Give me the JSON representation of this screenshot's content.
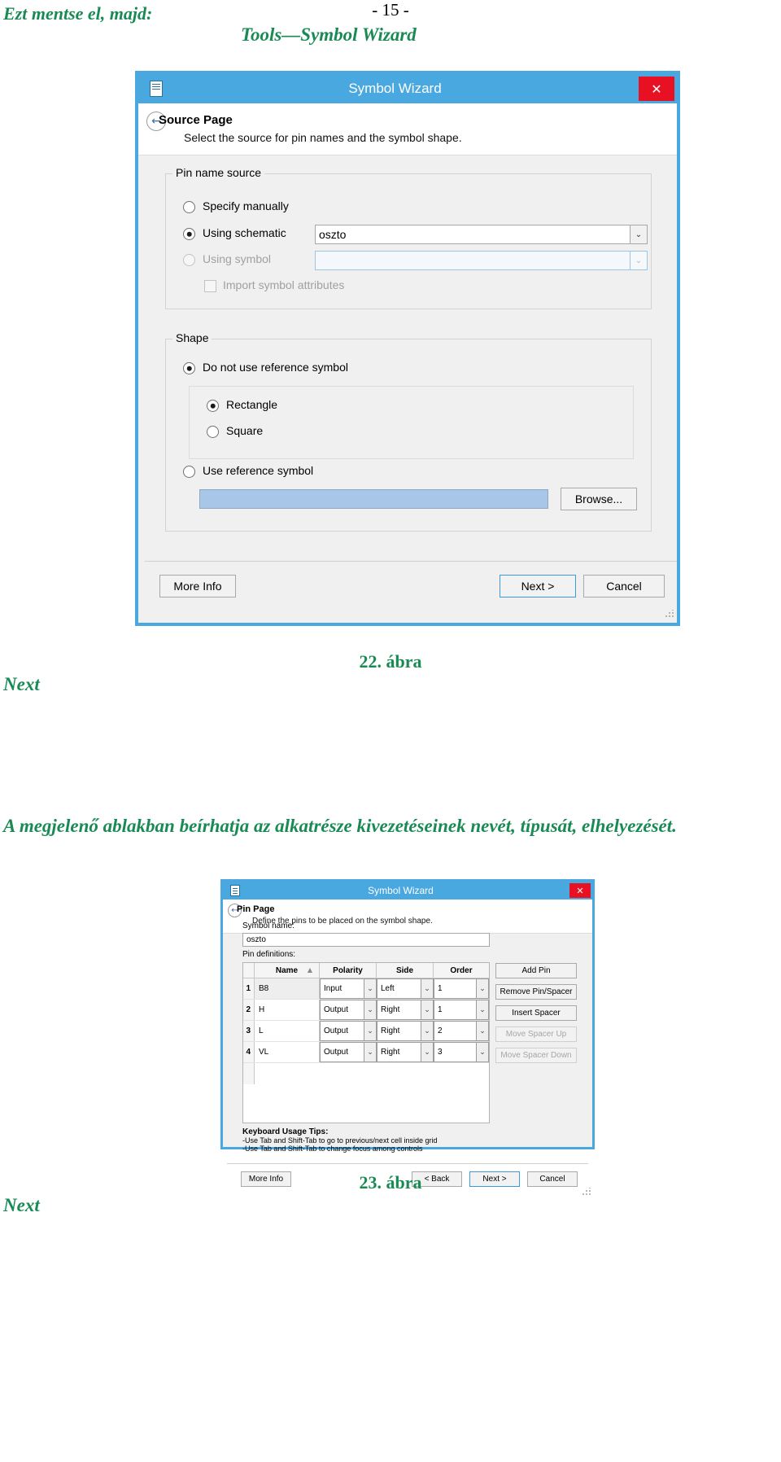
{
  "document": {
    "intro_line": "Ezt mentse el, majd:",
    "menu_path": "Tools—Symbol Wizard",
    "figure_22_caption": "22. ábra",
    "next_label_1": "Next",
    "paragraph": "A megjelenő ablakban beírhatja az alkatrésze kivezetéseinek nevét, típusát, elhelyezését.",
    "figure_23_caption": "23. ábra",
    "next_label_2": "Next",
    "page_number": "- 15 -",
    "accent_color": "#1a8a55"
  },
  "dialog_source_page": {
    "title": "Symbol Wizard",
    "titlebar_color": "#4aa8e0",
    "close_label": "✕",
    "header": {
      "title": "Source Page",
      "subtitle": "Select the source for pin names and the symbol shape.",
      "back_glyph": "←"
    },
    "pin_name_source": {
      "legend": "Pin name source",
      "options": [
        {
          "label": "Specify manually",
          "selected": false,
          "enabled": true
        },
        {
          "label": "Using schematic",
          "selected": true,
          "enabled": true
        },
        {
          "label": "Using symbol",
          "selected": false,
          "enabled": false
        }
      ],
      "schematic_value": "oszto",
      "symbol_value": "",
      "import_attributes": {
        "label": "Import symbol attributes",
        "checked": false,
        "enabled": false
      }
    },
    "shape": {
      "legend": "Shape",
      "do_not_use_reference": {
        "label": "Do not use reference symbol",
        "selected": true
      },
      "sub_options": [
        {
          "label": "Rectangle",
          "selected": true
        },
        {
          "label": "Square",
          "selected": false
        }
      ],
      "use_reference": {
        "label": "Use reference symbol",
        "selected": false
      },
      "reference_value": "",
      "browse_label": "Browse..."
    },
    "buttons": {
      "more_info": "More Info",
      "next": "Next >",
      "cancel": "Cancel"
    }
  },
  "dialog_pin_page": {
    "title": "Symbol Wizard",
    "close_label": "✕",
    "header": {
      "title": "Pin Page",
      "subtitle": "Define the pins to be placed on the symbol shape.",
      "back_glyph": "←"
    },
    "symbol_name_label": "Symbol name:",
    "symbol_name_value": "oszto",
    "pin_definitions_label": "Pin definitions:",
    "grid": {
      "columns": [
        "Name",
        "Polarity",
        "Side",
        "Order"
      ],
      "sort_indicator": "▲",
      "rows": [
        {
          "index": "1",
          "name": "B8",
          "polarity": "Input",
          "side": "Left",
          "order": "1"
        },
        {
          "index": "2",
          "name": "H",
          "polarity": "Output",
          "side": "Right",
          "order": "1"
        },
        {
          "index": "3",
          "name": "L",
          "polarity": "Output",
          "side": "Right",
          "order": "2"
        },
        {
          "index": "4",
          "name": "VL",
          "polarity": "Output",
          "side": "Right",
          "order": "3"
        }
      ]
    },
    "side_buttons": [
      {
        "label": "Add Pin",
        "enabled": true
      },
      {
        "label": "Remove Pin/Spacer",
        "enabled": true
      },
      {
        "label": "Insert Spacer",
        "enabled": true
      },
      {
        "label": "Move Spacer Up",
        "enabled": false
      },
      {
        "label": "Move Spacer Down",
        "enabled": false
      }
    ],
    "tips": {
      "title": "Keyboard Usage Tips:",
      "line1": "-Use Tab and Shift-Tab to go to previous/next cell inside grid",
      "line2": "-Use Tab and Shift-Tab to change focus among controls"
    },
    "buttons": {
      "more_info": "More Info",
      "back": "< Back",
      "next": "Next >",
      "cancel": "Cancel"
    }
  }
}
